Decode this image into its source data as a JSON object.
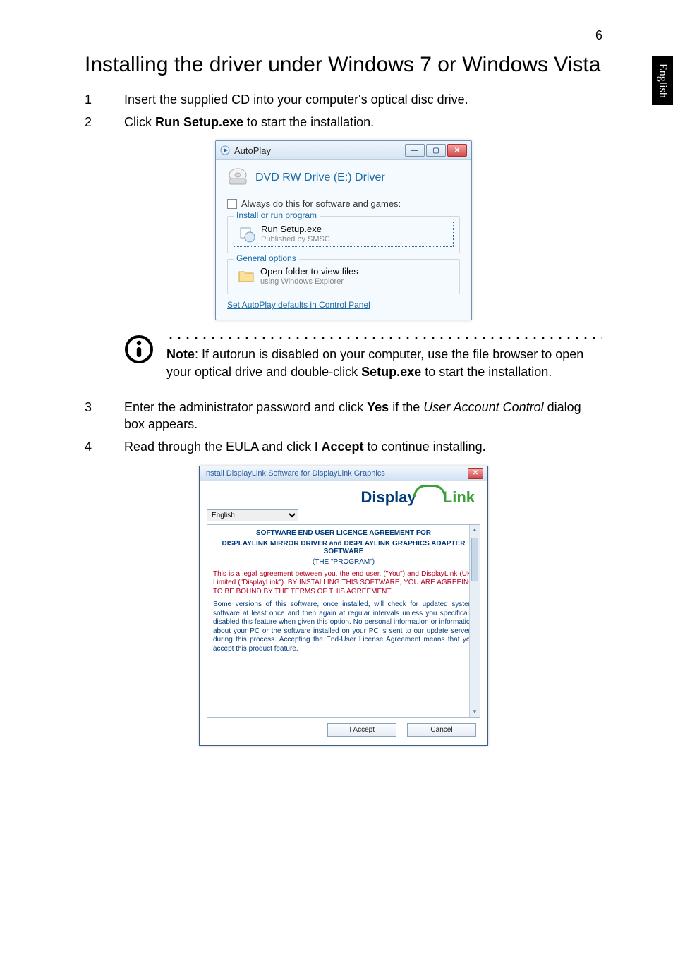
{
  "page_number": "6",
  "side_tab": "English",
  "heading": "Installing the driver under Windows 7 or Windows Vista",
  "steps": {
    "s1": {
      "num": "1",
      "text": "Insert the supplied CD into your computer's optical disc drive."
    },
    "s2": {
      "num": "2",
      "text_before": "Click ",
      "bold": "Run Setup.exe",
      "text_after": " to start the installation."
    },
    "s3": {
      "num": "3",
      "text_before": "Enter the administrator password and click ",
      "bold": "Yes",
      "text_mid": " if the ",
      "italic": "User Account Control",
      "text_after": " dialog box appears."
    },
    "s4": {
      "num": "4",
      "text_before": "Read through the EULA and click ",
      "bold": "I Accept",
      "text_after": " to continue installing."
    }
  },
  "autoplay": {
    "title": "AutoPlay",
    "drive": "DVD RW Drive (E:) Driver",
    "always": "Always do this for software and games:",
    "group_install": "Install or run program",
    "run_title": "Run Setup.exe",
    "run_sub": "Published by SMSC",
    "group_general": "General options",
    "open_title": "Open folder to view files",
    "open_sub": "using Windows Explorer",
    "link": "Set AutoPlay defaults in Control Panel"
  },
  "note": {
    "label": "Note",
    "text_before": ": If autorun is disabled on your computer, use the file browser to open your optical drive and double-click ",
    "bold": "Setup.exe",
    "text_after": " to start the installation."
  },
  "dl": {
    "title": "Install DisplayLink Software for DisplayLink Graphics",
    "logo_a": "Display",
    "logo_b": "Link",
    "lang": "English",
    "eula_h1": "SOFTWARE END USER LICENCE AGREEMENT FOR",
    "eula_h2": "DISPLAYLINK MIRROR DRIVER and DISPLAYLINK GRAPHICS ADAPTER SOFTWARE",
    "eula_h3": "(THE \"PROGRAM\")",
    "eula_red": "This is a legal agreement between you, the end user, (\"You\") and DisplayLink (UK) Limited (\"DisplayLink\"). BY INSTALLING THIS SOFTWARE, YOU ARE AGREEING TO BE BOUND BY THE TERMS OF THIS AGREEMENT.",
    "eula_blue": "Some versions of this software, once installed, will check for updated system software at least once and then again at regular intervals unless you specifically disabled this feature when given this option. No personal information or information about your PC or the software installed on your PC is sent to our update servers during this process. Accepting the End-User License Agreement means that you accept this product feature.",
    "btn_accept": "I Accept",
    "btn_cancel": "Cancel"
  }
}
